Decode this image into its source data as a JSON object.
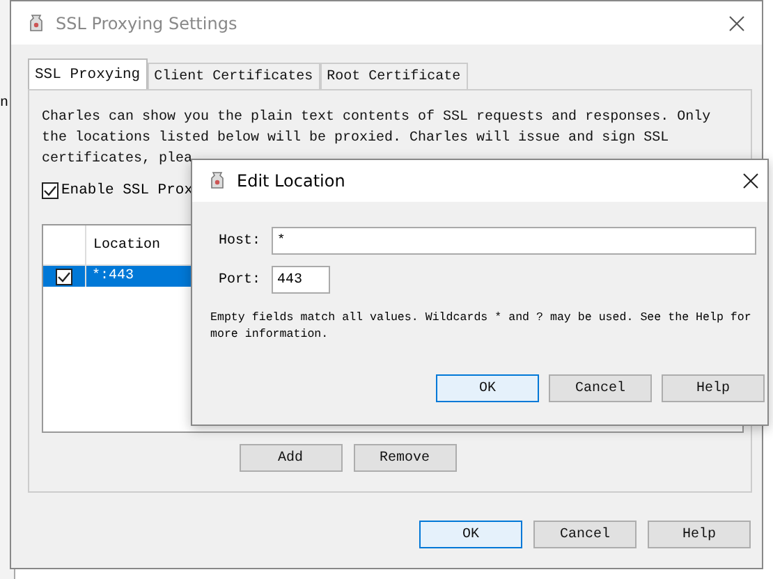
{
  "background_window": {
    "text": "n"
  },
  "settings_window": {
    "title": "SSL Proxying Settings",
    "tabs": [
      {
        "label": "SSL Proxying",
        "selected": true
      },
      {
        "label": "Client Certificates",
        "selected": false
      },
      {
        "label": "Root Certificate",
        "selected": false
      }
    ],
    "description_lines": [
      "Charles can show you the plain text contents of SSL requests and responses. Only",
      "the locations listed below will be proxied. Charles will issue and sign SSL",
      "certificates, plea"
    ],
    "enable_checkbox": {
      "label": "Enable SSL Prox",
      "checked": true
    },
    "table": {
      "columns": [
        "Location"
      ],
      "rows": [
        {
          "location": "*:443",
          "checked": true,
          "selected": true
        }
      ]
    },
    "list_buttons": [
      "Add",
      "Remove"
    ],
    "buttons": [
      {
        "label": "OK",
        "default": true
      },
      {
        "label": "Cancel",
        "default": false
      },
      {
        "label": "Help",
        "default": false
      }
    ]
  },
  "edit_dialog": {
    "title": "Edit Location",
    "fields": [
      {
        "label": "Host:",
        "value": "*",
        "wide": true
      },
      {
        "label": "Port:",
        "value": "443",
        "wide": false
      }
    ],
    "note": "Empty fields match all values. Wildcards * and ? may be used. See the Help for more information.",
    "buttons": [
      {
        "label": "OK",
        "default": true
      },
      {
        "label": "Cancel",
        "default": false
      },
      {
        "label": "Help",
        "default": false
      }
    ]
  }
}
